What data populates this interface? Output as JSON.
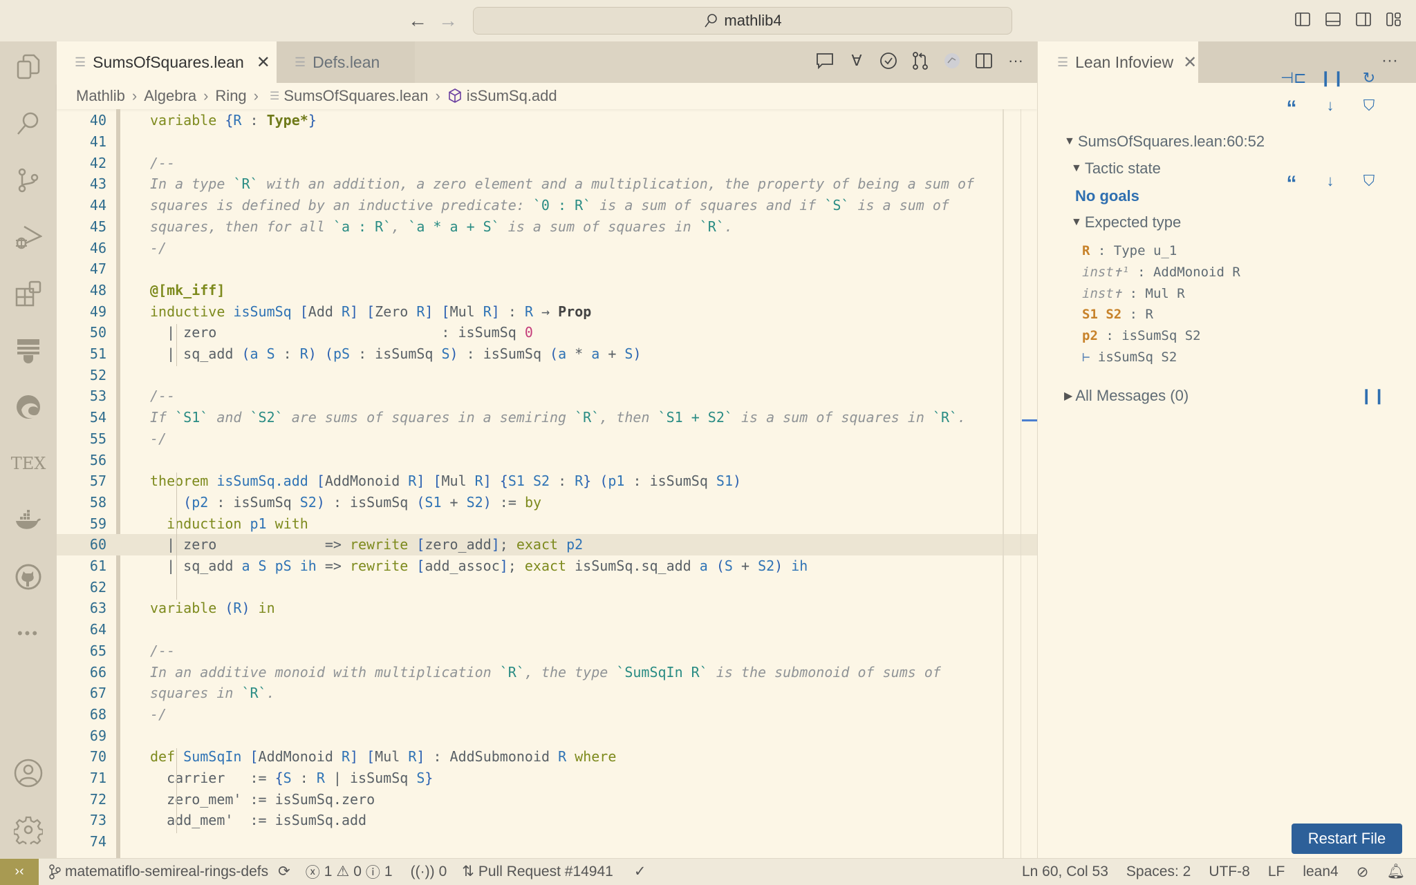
{
  "titlebar": {
    "back_icon": "arrow-left-icon",
    "forward_icon": "arrow-right-icon",
    "search_text": "mathlib4",
    "layout_icons": [
      "toggle-primary-sidebar-icon",
      "toggle-panel-icon",
      "toggle-secondary-sidebar-icon",
      "customize-layout-icon"
    ]
  },
  "activitybar": {
    "items": [
      "explorer-icon",
      "search-icon",
      "source-control-icon",
      "run-debug-icon",
      "extensions-icon",
      "lean-icon",
      "edge-icon",
      "tex-icon",
      "docker-icon",
      "github-icon",
      "more-icon"
    ],
    "bottom": [
      "accounts-icon",
      "manage-gear-icon"
    ],
    "tex_label": "TEX"
  },
  "editor": {
    "tabs": [
      {
        "label": "SumsOfSquares.lean",
        "active": true
      },
      {
        "label": "Defs.lean",
        "active": false
      }
    ],
    "actions": [
      "comment-icon",
      "forall-icon",
      "check-circle-icon",
      "git-compare-icon",
      "avatar-icon",
      "split-editor-icon",
      "more-actions-icon"
    ],
    "breadcrumbs": [
      "Mathlib",
      "Algebra",
      "Ring",
      "SumsOfSquares.lean",
      "isSumSq.add"
    ],
    "current_line": 60,
    "lines": [
      {
        "n": "40",
        "t": [
          [
            "kw",
            "variable "
          ],
          [
            "br",
            "{"
          ],
          [
            "var",
            "R"
          ],
          [
            "plain",
            " : "
          ],
          [
            "ty",
            "Type*"
          ],
          [
            "br",
            "}"
          ]
        ]
      },
      {
        "n": "41",
        "t": []
      },
      {
        "n": "42",
        "t": [
          [
            "cm",
            "/--"
          ]
        ]
      },
      {
        "n": "43",
        "t": [
          [
            "cm",
            "In a type "
          ],
          [
            "cmcode",
            "`R`"
          ],
          [
            "cm",
            " with an addition, a zero element and a multiplication, the property of being a sum of"
          ]
        ]
      },
      {
        "n": "44",
        "t": [
          [
            "cm",
            "squares is defined by an inductive predicate: "
          ],
          [
            "cmcode",
            "`0 : R`"
          ],
          [
            "cm",
            " is a sum of squares and if "
          ],
          [
            "cmcode",
            "`S`"
          ],
          [
            "cm",
            " is a sum of"
          ]
        ]
      },
      {
        "n": "45",
        "t": [
          [
            "cm",
            "squares, then for all "
          ],
          [
            "cmcode",
            "`a : R`"
          ],
          [
            "cm",
            ", "
          ],
          [
            "cmcode",
            "`a * a + S`"
          ],
          [
            "cm",
            " is a sum of squares in "
          ],
          [
            "cmcode",
            "`R`"
          ],
          [
            "cm",
            "."
          ]
        ]
      },
      {
        "n": "46",
        "t": [
          [
            "cm",
            "-/"
          ]
        ]
      },
      {
        "n": "47",
        "t": []
      },
      {
        "n": "48",
        "t": [
          [
            "kwb",
            "@[mk_iff]"
          ]
        ]
      },
      {
        "n": "49",
        "t": [
          [
            "kw",
            "inductive "
          ],
          [
            "fn",
            "isSumSq "
          ],
          [
            "br",
            "["
          ],
          [
            "plain",
            "Add "
          ],
          [
            "var",
            "R"
          ],
          [
            "br",
            "]"
          ],
          [
            "plain",
            " "
          ],
          [
            "br",
            "["
          ],
          [
            "plain",
            "Zero "
          ],
          [
            "var",
            "R"
          ],
          [
            "br",
            "]"
          ],
          [
            "plain",
            " "
          ],
          [
            "br",
            "["
          ],
          [
            "plain",
            "Mul "
          ],
          [
            "var",
            "R"
          ],
          [
            "br",
            "]"
          ],
          [
            "plain",
            " : "
          ],
          [
            "var",
            "R"
          ],
          [
            "plain",
            " → "
          ],
          [
            "prop",
            "Prop"
          ]
        ]
      },
      {
        "n": "50",
        "t": [
          [
            "plain",
            "  | zero                           : isSumSq "
          ],
          [
            "num",
            "0"
          ]
        ]
      },
      {
        "n": "51",
        "t": [
          [
            "plain",
            "  | sq_add "
          ],
          [
            "br",
            "("
          ],
          [
            "var",
            "a S"
          ],
          [
            "plain",
            " : "
          ],
          [
            "var",
            "R"
          ],
          [
            "br",
            ")"
          ],
          [
            "plain",
            " "
          ],
          [
            "br",
            "("
          ],
          [
            "var",
            "pS"
          ],
          [
            "plain",
            " : isSumSq "
          ],
          [
            "var",
            "S"
          ],
          [
            "br",
            ")"
          ],
          [
            "plain",
            " : isSumSq "
          ],
          [
            "br",
            "("
          ],
          [
            "var",
            "a"
          ],
          [
            "plain",
            " * "
          ],
          [
            "var",
            "a"
          ],
          [
            "plain",
            " + "
          ],
          [
            "var",
            "S"
          ],
          [
            "br",
            ")"
          ]
        ]
      },
      {
        "n": "52",
        "t": []
      },
      {
        "n": "53",
        "t": [
          [
            "cm",
            "/--"
          ]
        ]
      },
      {
        "n": "54",
        "t": [
          [
            "cm",
            "If "
          ],
          [
            "cmcode",
            "`S1`"
          ],
          [
            "cm",
            " and "
          ],
          [
            "cmcode",
            "`S2`"
          ],
          [
            "cm",
            " are sums of squares in a semiring "
          ],
          [
            "cmcode",
            "`R`"
          ],
          [
            "cm",
            ", then "
          ],
          [
            "cmcode",
            "`S1 + S2`"
          ],
          [
            "cm",
            " is a sum of squares in "
          ],
          [
            "cmcode",
            "`R`"
          ],
          [
            "cm",
            "."
          ]
        ]
      },
      {
        "n": "55",
        "t": [
          [
            "cm",
            "-/"
          ]
        ]
      },
      {
        "n": "56",
        "t": []
      },
      {
        "n": "57",
        "t": [
          [
            "kw",
            "theorem "
          ],
          [
            "fn",
            "isSumSq.add "
          ],
          [
            "br",
            "["
          ],
          [
            "plain",
            "AddMonoid "
          ],
          [
            "var",
            "R"
          ],
          [
            "br",
            "]"
          ],
          [
            "plain",
            " "
          ],
          [
            "br",
            "["
          ],
          [
            "plain",
            "Mul "
          ],
          [
            "var",
            "R"
          ],
          [
            "br",
            "]"
          ],
          [
            "plain",
            " "
          ],
          [
            "br",
            "{"
          ],
          [
            "var",
            "S1 S2"
          ],
          [
            "plain",
            " : "
          ],
          [
            "var",
            "R"
          ],
          [
            "br",
            "}"
          ],
          [
            "plain",
            " "
          ],
          [
            "br",
            "("
          ],
          [
            "var",
            "p1"
          ],
          [
            "plain",
            " : isSumSq "
          ],
          [
            "var",
            "S1"
          ],
          [
            "br",
            ")"
          ]
        ]
      },
      {
        "n": "58",
        "t": [
          [
            "plain",
            "    "
          ],
          [
            "br",
            "("
          ],
          [
            "var",
            "p2"
          ],
          [
            "plain",
            " : isSumSq "
          ],
          [
            "var",
            "S2"
          ],
          [
            "br",
            ")"
          ],
          [
            "plain",
            " : isSumSq "
          ],
          [
            "br",
            "("
          ],
          [
            "var",
            "S1"
          ],
          [
            "plain",
            " + "
          ],
          [
            "var",
            "S2"
          ],
          [
            "br",
            ")"
          ],
          [
            "plain",
            " := "
          ],
          [
            "kw",
            "by"
          ]
        ]
      },
      {
        "n": "59",
        "t": [
          [
            "plain",
            "  "
          ],
          [
            "kw",
            "induction "
          ],
          [
            "var",
            "p1"
          ],
          [
            "kw",
            " with"
          ]
        ]
      },
      {
        "n": "60",
        "t": [
          [
            "plain",
            "  | zero             => "
          ],
          [
            "kw",
            "rewrite "
          ],
          [
            "br",
            "["
          ],
          [
            "plain",
            "zero_add"
          ],
          [
            "br",
            "]"
          ],
          [
            "plain",
            "; "
          ],
          [
            "kw",
            "exact "
          ],
          [
            "var",
            "p2"
          ]
        ]
      },
      {
        "n": "61",
        "t": [
          [
            "plain",
            "  | sq_add "
          ],
          [
            "var",
            "a S pS ih"
          ],
          [
            "plain",
            " => "
          ],
          [
            "kw",
            "rewrite "
          ],
          [
            "br",
            "["
          ],
          [
            "plain",
            "add_assoc"
          ],
          [
            "br",
            "]"
          ],
          [
            "plain",
            "; "
          ],
          [
            "kw",
            "exact "
          ],
          [
            "plain",
            "isSumSq.sq_add "
          ],
          [
            "var",
            "a"
          ],
          [
            "plain",
            " "
          ],
          [
            "br",
            "("
          ],
          [
            "var",
            "S"
          ],
          [
            "plain",
            " + "
          ],
          [
            "var",
            "S2"
          ],
          [
            "br",
            ")"
          ],
          [
            "plain",
            " "
          ],
          [
            "var",
            "ih"
          ]
        ]
      },
      {
        "n": "62",
        "t": []
      },
      {
        "n": "63",
        "t": [
          [
            "kw",
            "variable "
          ],
          [
            "br",
            "("
          ],
          [
            "var",
            "R"
          ],
          [
            "br",
            ")"
          ],
          [
            "kw",
            " in"
          ]
        ]
      },
      {
        "n": "64",
        "t": []
      },
      {
        "n": "65",
        "t": [
          [
            "cm",
            "/--"
          ]
        ]
      },
      {
        "n": "66",
        "t": [
          [
            "cm",
            "In an additive monoid with multiplication "
          ],
          [
            "cmcode",
            "`R`"
          ],
          [
            "cm",
            ", the type "
          ],
          [
            "cmcode",
            "`SumSqIn R`"
          ],
          [
            "cm",
            " is the submonoid of sums of"
          ]
        ]
      },
      {
        "n": "67",
        "t": [
          [
            "cm",
            "squares in "
          ],
          [
            "cmcode",
            "`R`"
          ],
          [
            "cm",
            "."
          ]
        ]
      },
      {
        "n": "68",
        "t": [
          [
            "cm",
            "-/"
          ]
        ]
      },
      {
        "n": "69",
        "t": []
      },
      {
        "n": "70",
        "t": [
          [
            "kw",
            "def "
          ],
          [
            "fn",
            "SumSqIn "
          ],
          [
            "br",
            "["
          ],
          [
            "plain",
            "AddMonoid "
          ],
          [
            "var",
            "R"
          ],
          [
            "br",
            "]"
          ],
          [
            "plain",
            " "
          ],
          [
            "br",
            "["
          ],
          [
            "plain",
            "Mul "
          ],
          [
            "var",
            "R"
          ],
          [
            "br",
            "]"
          ],
          [
            "plain",
            " : AddSubmonoid "
          ],
          [
            "var",
            "R"
          ],
          [
            "kw",
            " where"
          ]
        ]
      },
      {
        "n": "71",
        "t": [
          [
            "plain",
            "  carrier   := "
          ],
          [
            "br",
            "{"
          ],
          [
            "var",
            "S"
          ],
          [
            "plain",
            " : "
          ],
          [
            "var",
            "R"
          ],
          [
            "plain",
            " | isSumSq "
          ],
          [
            "var",
            "S"
          ],
          [
            "br",
            "}"
          ]
        ]
      },
      {
        "n": "72",
        "t": [
          [
            "plain",
            "  zero_mem' := isSumSq.zero"
          ]
        ]
      },
      {
        "n": "73",
        "t": [
          [
            "plain",
            "  add_mem'  := isSumSq.add"
          ]
        ]
      },
      {
        "n": "74",
        "t": []
      }
    ]
  },
  "infoview": {
    "tab_label": "Lean Infoview",
    "location": "SumsOfSquares.lean:60:52",
    "tactic_state_label": "Tactic state",
    "no_goals": "No goals",
    "expected_type_label": "Expected type",
    "hypotheses": [
      {
        "names": "R",
        "kind": "name",
        "type": "Type u_1"
      },
      {
        "names": "inst✝¹",
        "kind": "inst",
        "type": "AddMonoid R"
      },
      {
        "names": "inst✝",
        "kind": "inst",
        "type": "Mul R"
      },
      {
        "names": "S1 S2",
        "kind": "name",
        "type": "R"
      },
      {
        "names": "p2",
        "kind": "name",
        "type": "isSumSq S2"
      }
    ],
    "goal": "isSumSq S2",
    "turnstile": "⊢",
    "all_messages": "All Messages (0)",
    "restart_label": "Restart File",
    "header_icons": [
      "pin-icon",
      "pause-icon",
      "refresh-icon"
    ],
    "tactic_icons": [
      "quote-icon",
      "arrow-down-icon",
      "filter-icon"
    ],
    "expected_icons": [
      "quote-icon",
      "arrow-down-icon",
      "filter-icon"
    ]
  },
  "statusbar": {
    "branch": "matematiflo-semireal-rings-defs",
    "errors": "1",
    "warnings": "0",
    "infos": "1",
    "ports": "0",
    "pull_request": "Pull Request #14941",
    "position": "Ln 60, Col 53",
    "spaces": "Spaces: 2",
    "encoding": "UTF-8",
    "eol": "LF",
    "language": "lean4"
  },
  "colors": {
    "accent": "#2d6099",
    "remote": "#a89a52",
    "keyword": "#7d8a1d",
    "identifier": "#2f73b5",
    "comment": "#8f9396",
    "hyp_name": "#c7822a"
  }
}
